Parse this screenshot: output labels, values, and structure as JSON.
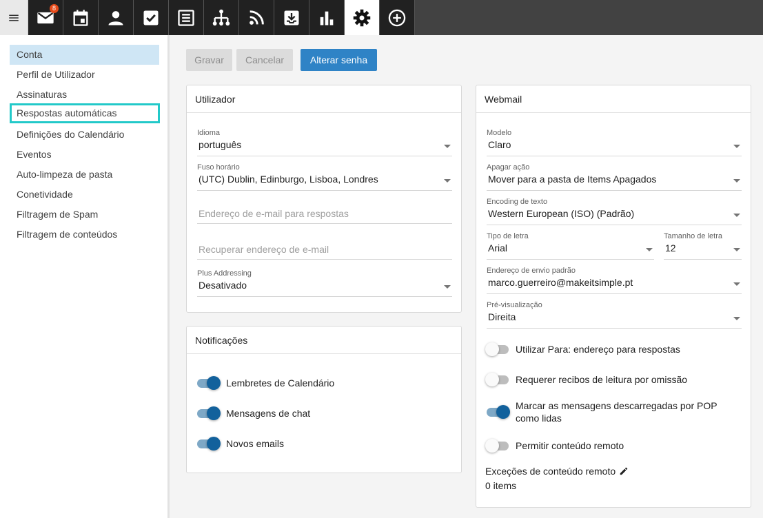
{
  "topbar": {
    "items": [
      {
        "icon": "menu-icon"
      },
      {
        "icon": "mail-icon",
        "badge": "8"
      },
      {
        "icon": "calendar-icon"
      },
      {
        "icon": "contacts-icon"
      },
      {
        "icon": "tasks-icon"
      },
      {
        "icon": "notes-icon"
      },
      {
        "icon": "org-chart-icon"
      },
      {
        "icon": "rss-icon"
      },
      {
        "icon": "inbox-download-icon"
      },
      {
        "icon": "stats-icon"
      },
      {
        "icon": "settings-icon",
        "active": true
      },
      {
        "icon": "add-circle-icon"
      }
    ]
  },
  "sidebar": {
    "items": [
      {
        "label": "Conta"
      },
      {
        "label": "Perfil de Utilizador"
      },
      {
        "label": "Assinaturas"
      },
      {
        "label": "Respostas automáticas"
      },
      {
        "label": "Definições do Calendário"
      },
      {
        "label": "Eventos"
      },
      {
        "label": "Auto-limpeza de pasta"
      },
      {
        "label": "Conetividade"
      },
      {
        "label": "Filtragem de Spam"
      },
      {
        "label": "Filtragem de conteúdos"
      }
    ]
  },
  "toolbar": {
    "save_label": "Gravar",
    "cancel_label": "Cancelar",
    "change_password_label": "Alterar senha"
  },
  "user_card": {
    "title": "Utilizador",
    "language_label": "Idioma",
    "language_value": "português",
    "timezone_label": "Fuso horário",
    "timezone_value": "(UTC) Dublin, Edinburgo, Lisboa, Londres",
    "reply_email_placeholder": "Endereço de e-mail para respostas",
    "recovery_email_placeholder": "Recuperar endereço de e-mail",
    "plus_addressing_label": "Plus Addressing",
    "plus_addressing_value": "Desativado"
  },
  "notifications_card": {
    "title": "Notificações",
    "items": [
      {
        "label": "Lembretes de Calendário",
        "on": true
      },
      {
        "label": "Mensagens de chat",
        "on": true
      },
      {
        "label": "Novos emails",
        "on": true
      }
    ]
  },
  "webmail_card": {
    "title": "Webmail",
    "model_label": "Modelo",
    "model_value": "Claro",
    "delete_action_label": "Apagar ação",
    "delete_action_value": "Mover para a pasta de Items Apagados",
    "encoding_label": "Encoding de texto",
    "encoding_value": "Western European (ISO) (Padrão)",
    "font_label": "Tipo de letra",
    "font_value": "Arial",
    "font_size_label": "Tamanho de letra",
    "font_size_value": "12",
    "default_sender_label": "Endereço de envio padrão",
    "default_sender_value": "marco.guerreiro@makeitsimple.pt",
    "preview_label": "Pré-visualização",
    "preview_value": "Direita",
    "toggles": [
      {
        "label": "Utilizar Para: endereço para respostas",
        "on": false
      },
      {
        "label": "Requerer recibos de leitura por omissão",
        "on": false
      },
      {
        "label": "Marcar as mensagens descarregadas por POP",
        "label2": "como lidas",
        "on": true
      },
      {
        "label": "Permitir conteúdo remoto",
        "on": false
      }
    ],
    "remote_exceptions_label": "Exceções de conteúdo remoto",
    "remote_exceptions_count": "0 items"
  },
  "colors": {
    "topbar": "#424242",
    "accent": "#2f83c6",
    "toggle_on": "#12619c",
    "highlight": "#22c9c9"
  }
}
